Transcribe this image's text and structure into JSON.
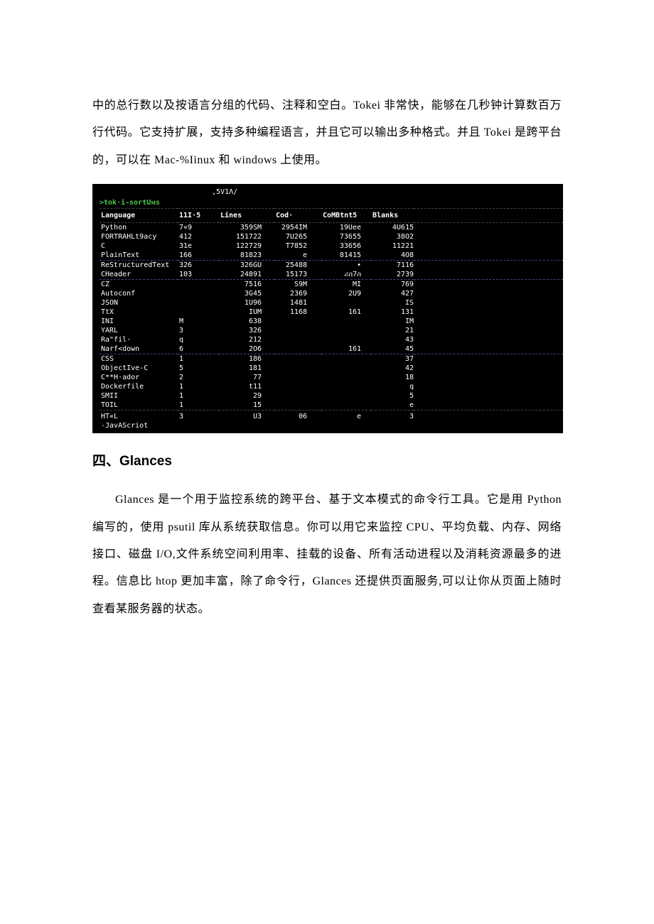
{
  "para1": "中的总行数以及按语言分组的代码、注释和空白。Tokei 非常快，能够在几秒钟计算数百万行代码。它支持扩展，支持多种编程语言，并且它可以输出多种格式。并且 Tokei 是跨平台的，可以在 Mac-%Iinux 和 windows 上使用。",
  "terminal": {
    "version": ",5V1Λ/",
    "prompt": ">tok·i-sortUᴍs",
    "headers": [
      "Language",
      "11I·5",
      "Lines",
      "Cod·",
      "CoMBtnt5",
      "Blanks"
    ],
    "rows": [
      [
        "Python",
        "7«9",
        "359SM",
        "2954IM",
        "19Uee",
        "4U615"
      ],
      [
        "FORTRAHLt9acy",
        "412",
        "151722",
        "7U265",
        "73655",
        "38O2"
      ],
      [
        "C",
        "31e",
        "122729",
        "T7852",
        "33656",
        "11221"
      ],
      [
        "PlainText",
        "166",
        "81823",
        "e",
        "81415",
        "4O8"
      ],
      [
        "ReStructuredText",
        "326",
        "326GU",
        "25488",
        "•",
        "7116"
      ],
      [
        "CHeader",
        "103",
        "24891",
        "15173",
        "ሪስ7ስ",
        "2739"
      ],
      [
        "CZ",
        "",
        "7516",
        "S9M",
        "MI",
        "769"
      ],
      [
        "Autoconf",
        "",
        "3G45",
        "2369",
        "2U9",
        "427"
      ],
      [
        "JSON",
        "",
        "1U96",
        "1481",
        "",
        "IS"
      ],
      [
        "TtX",
        "",
        "IUM",
        "1168",
        "161",
        "131"
      ],
      [
        "INI",
        "M",
        "638",
        "",
        "",
        "IM"
      ],
      [
        "YARL",
        "3",
        "326",
        "",
        "",
        "21"
      ],
      [
        "Ra\"fil·",
        "q",
        "212",
        "",
        "",
        "43"
      ],
      [
        "Narf<down",
        "6",
        "2O6",
        "",
        "161",
        "45"
      ],
      [
        "CSS",
        "1",
        "186",
        "",
        "",
        "37"
      ],
      [
        "ObjectIve-C",
        "5",
        "181",
        "",
        "",
        "42"
      ],
      [
        "C**H·ador",
        "2",
        "77",
        "",
        "",
        "18"
      ],
      [
        "Dockerfile",
        "1",
        "t11",
        "",
        "",
        "q"
      ],
      [
        "SMII",
        "1",
        "29",
        "",
        "",
        "5"
      ],
      [
        "TOIL",
        "1",
        "15",
        "",
        "",
        "e"
      ]
    ],
    "footer": [
      "HT«L",
      "3",
      "U3",
      "06",
      "e",
      "3"
    ],
    "sub": "-JavAScriot"
  },
  "section4_title": "四、Glances",
  "para2": "Glances 是一个用于监控系统的跨平台、基于文本模式的命令行工具。它是用 Python 编写的，使用 psutil 库从系统获取信息。你可以用它来监控 CPU、平均负载、内存、网络接口、磁盘 I/O,文件系统空间利用率、挂载的设备、所有活动进程以及消耗资源最多的进程。信息比 htop 更加丰富，除了命令行，Glances 还提供页面服务,可以让你从页面上随时查看某服务器的状态。"
}
